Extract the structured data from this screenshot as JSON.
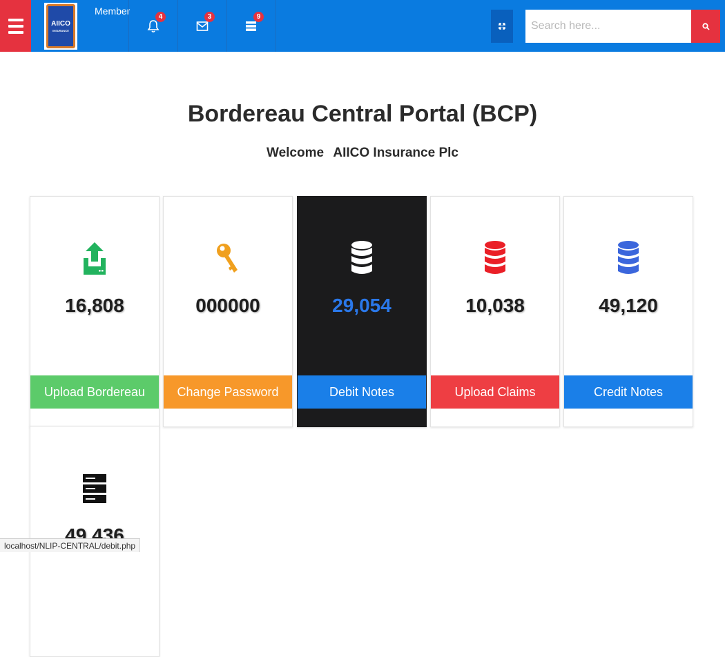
{
  "header": {
    "member_label": "Member",
    "logo_text": "AIICO",
    "logo_subtext": "INSURANCE",
    "badges": {
      "notifications": "4",
      "messages": "3",
      "tasks": "9"
    },
    "search_placeholder": "Search here...",
    "icons": {
      "menu": "hamburger-icon",
      "notifications": "bell-icon",
      "messages": "envelope-icon",
      "tasks": "list-icon",
      "fullscreen": "expand-icon",
      "search": "search-icon"
    }
  },
  "main": {
    "title": "Bordereau Central Portal (BCP)",
    "welcome_label": "Welcome",
    "company_name": "AIICO Insurance Plc"
  },
  "cards": [
    {
      "icon": "upload-icon",
      "icon_color": "#22b35e",
      "value": "16,808",
      "button": "Upload Bordereau",
      "button_color": "#5ccb6a"
    },
    {
      "icon": "key-icon",
      "icon_color": "#f0a01e",
      "value": "000000",
      "button": "Change Password",
      "button_color": "#f7982a"
    },
    {
      "icon": "database-icon",
      "icon_color": "#ffffff",
      "value": "29,054",
      "button": "Debit Notes",
      "button_color": "#1a7fe8",
      "value_color": "#2a78ea"
    },
    {
      "icon": "database-icon",
      "icon_color": "#ea1f27",
      "value": "10,038",
      "button": "Upload Claims",
      "button_color": "#ee3e43"
    },
    {
      "icon": "database-icon",
      "icon_color": "#3b66dc",
      "value": "49,120",
      "button": "Credit Notes",
      "button_color": "#1a7fe8"
    },
    {
      "icon": "server-icon",
      "icon_color": "#111111",
      "value": "49,436"
    }
  ],
  "status_bar": {
    "url": "localhost/NLIP-CENTRAL/debit.php"
  }
}
